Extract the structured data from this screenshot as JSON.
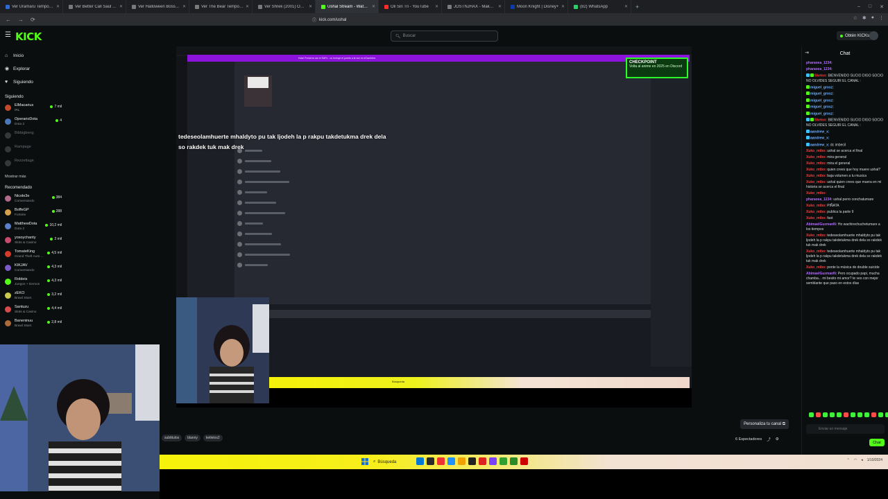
{
  "browser": {
    "tabs": [
      {
        "title": "Ver Uramaru Temporada 3 Episo",
        "color": "#2d6cd6",
        "active": false
      },
      {
        "title": "Ver Better Call Saul Temporada 4 Ep",
        "color": "#7a7a7a",
        "active": false
      },
      {
        "title": "Ver Halloween Boss Temporada 2 Episo",
        "color": "#7a7a7a",
        "active": false
      },
      {
        "title": "Ver The Bear Temporada 3 Episodio",
        "color": "#7a7a7a",
        "active": false
      },
      {
        "title": "Ver Shrek (2001) Online - Peliplus",
        "color": "#7a7a7a",
        "active": false
      },
      {
        "title": "Ushal Stream - Watch Live on",
        "color": "#53fc18",
        "active": true
      },
      {
        "title": "Oli Sin Tri - YouTube",
        "color": "#ff2b2b",
        "active": false
      },
      {
        "title": "JOSTNJHAX - Make Your Day",
        "color": "#7a7a7a",
        "active": false
      },
      {
        "title": "Moon Knight | Disney+",
        "color": "#0a3cb0",
        "active": false
      },
      {
        "title": "(82) WhatsApp",
        "color": "#25d366",
        "active": false
      }
    ],
    "new_tab": "+",
    "window_controls": [
      "–",
      "□",
      "✕"
    ],
    "url": "kick.com/ushal",
    "nav": [
      "←",
      "→",
      "⟳"
    ]
  },
  "kick": {
    "logo": "KICK",
    "search_placeholder": "Buscar",
    "get_kicks": "Obtén KICKs"
  },
  "sidebar": {
    "nav": [
      {
        "label": "Inicio",
        "icon": "home-icon",
        "glyph": "⌂"
      },
      {
        "label": "Explorar",
        "icon": "compass-icon",
        "glyph": "◉"
      },
      {
        "label": "Siguiendo",
        "icon": "heart-icon",
        "glyph": "♥"
      }
    ],
    "following_title": "Siguiendo",
    "following": [
      {
        "name": "ElMacarius",
        "category": "IRL",
        "viewers": "7 mil",
        "live": true,
        "color": "#c54a2c"
      },
      {
        "name": "OperarioDota",
        "category": "Dota 2",
        "viewers": "4",
        "live": true,
        "color": "#4a78b8"
      },
      {
        "name": "Bibbigbeng",
        "category": "",
        "viewers": "",
        "live": false,
        "color": "#888"
      },
      {
        "name": "Rampage",
        "category": "",
        "viewers": "",
        "live": false,
        "color": "#888"
      },
      {
        "name": "Rezzettage",
        "category": "",
        "viewers": "",
        "live": false,
        "color": "#888"
      }
    ],
    "show_more": "Mostrar más",
    "recommended_title": "Recomendado",
    "recommended": [
      {
        "name": "Nicole3e",
        "category": "Conversando",
        "viewers": "384",
        "color": "#b06a8a"
      },
      {
        "name": "BoffeGP",
        "category": "Fortnite",
        "viewers": "288",
        "color": "#d6a24a"
      },
      {
        "name": "MatthewDota",
        "category": "Dota 2",
        "viewers": "10,2 mil",
        "color": "#5b7ec9"
      },
      {
        "name": "yosoychanty",
        "category": "Slots & Casino",
        "viewers": "2 mil",
        "color": "#c94a6c"
      },
      {
        "name": "TomateKing",
        "category": "Grand Theft Auto ...",
        "viewers": "4,5 mil",
        "color": "#d63a2a"
      },
      {
        "name": "KIKJAV",
        "category": "Conversando",
        "viewers": "4,3 mil",
        "color": "#7a5bc9"
      },
      {
        "name": "Robleis",
        "category": "Juegos + Demos",
        "viewers": "4,3 mil",
        "color": "#53fc18"
      },
      {
        "name": "zEKO",
        "category": "Brawl Stars",
        "viewers": "3,2 mil",
        "color": "#c9c94a"
      },
      {
        "name": "Santuzu",
        "category": "Slots & Casino",
        "viewers": "4,4 mil",
        "color": "#d64a4a"
      },
      {
        "name": "Baneninuu",
        "category": "Brawl Stars",
        "viewers": "2,8 mil",
        "color": "#aa6a3a"
      }
    ]
  },
  "stream": {
    "overlay_text": "tedeseolamhuerte mhaldyto pu tak ljodeh la p rakpu takdetukma drek dela so rakdek tuk mak drek",
    "checkpoint_title": "CHECKPOINT",
    "checkpoint_sub": "Volta al anime en 2025 en Discord",
    "banner": "Hola! Preserve am el SAFe - co Incluye el puerto a la vez en el tambien."
  },
  "below": {
    "tags": [
      "subtitulos",
      "blanny",
      "ketlelos2"
    ],
    "customize": "Personaliza tu canal ⧉",
    "viewers": "6 Espectadores"
  },
  "chat": {
    "title": "Chat",
    "messages": [
      {
        "user": "pharaoea_1234:",
        "text": "",
        "color": "#b36bff",
        "badges": []
      },
      {
        "user": "pharaoea_1234:",
        "text": "",
        "color": "#b36bff",
        "badges": []
      },
      {
        "user": "Skelon:",
        "text": "BIENVENIDO SUCIO DIGO SOCIO NO OLVIDES SEGUIR EL CANAL :",
        "color": "#ff3b3b",
        "badges": [
          "#3ec1ff",
          "#53fc18"
        ]
      },
      {
        "user": "miguel_grosz:",
        "text": "",
        "color": "#6fb0ff",
        "badges": [
          "#53fc18"
        ]
      },
      {
        "user": "miguel_grosz:",
        "text": "",
        "color": "#6fb0ff",
        "badges": [
          "#53fc18"
        ]
      },
      {
        "user": "miguel_grosz:",
        "text": "",
        "color": "#6fb0ff",
        "badges": [
          "#53fc18"
        ]
      },
      {
        "user": "miguel_grosz:",
        "text": "",
        "color": "#6fb0ff",
        "badges": [
          "#53fc18"
        ]
      },
      {
        "user": "miguel_grosz:",
        "text": "",
        "color": "#6fb0ff",
        "badges": [
          "#53fc18"
        ]
      },
      {
        "user": "Skelon:",
        "text": "BIENVENIDO SUCIO DIGO SOCIO NO OLVIDES SEGUIR EL CANAL :",
        "color": "#ff3b3b",
        "badges": [
          "#3ec1ff",
          "#53fc18"
        ]
      },
      {
        "user": "aandrew_x:",
        "text": "",
        "color": "#6fb0ff",
        "badges": [
          "#3ec1ff"
        ]
      },
      {
        "user": "aandrew_x:",
        "text": "",
        "color": "#6fb0ff",
        "badges": [
          "#3ec1ff"
        ]
      },
      {
        "user": "aandrew_x:",
        "text": "dc imbecil",
        "color": "#6fb0ff",
        "badges": [
          "#3ec1ff"
        ]
      },
      {
        "user": "Xuko_mtbo:",
        "text": "ushal se acerca el final",
        "color": "#ff3b3b",
        "badges": []
      },
      {
        "user": "Xuko_mtbo:",
        "text": "mira general",
        "color": "#ff3b3b",
        "badges": []
      },
      {
        "user": "Xuko_mtbo:",
        "text": "mira el general",
        "color": "#ff3b3b",
        "badges": []
      },
      {
        "user": "Xuko_mtbo:",
        "text": "quien crees que hoy muere ushal?",
        "color": "#ff3b3b",
        "badges": []
      },
      {
        "user": "Xuko_mtbo:",
        "text": "baja volumen a tu musica",
        "color": "#ff3b3b",
        "badges": []
      },
      {
        "user": "Xuko_mtbo:",
        "text": "ushal quien crees que muera en mi historia se acerca el final",
        "color": "#ff3b3b",
        "badges": []
      },
      {
        "user": "Xuko_mtbo:",
        "text": "",
        "color": "#ff3b3b",
        "badges": []
      },
      {
        "user": "pharaoea_1234:",
        "text": "ushal perro conchatumare",
        "color": "#b36bff",
        "badges": []
      },
      {
        "user": "Xuko_mtbo:",
        "text": "PIÑATA",
        "color": "#ff3b3b",
        "badges": []
      },
      {
        "user": "Xuko_mtbo:",
        "text": "publica la parte 9",
        "color": "#ff3b3b",
        "badges": []
      },
      {
        "user": "Xuko_mtbo:",
        "text": "fast",
        "color": "#ff3b3b",
        "badges": []
      },
      {
        "user": "AbimaelGuzmanN:",
        "text": "Ho wachirechuchetumare a los tiempos",
        "color": "#b36bff",
        "badges": []
      },
      {
        "user": "Xuko_mtbo:",
        "text": "tedeseolamhuerte mhaldyto pu tak ljodeh la p rakpu takdetukma drek dela so rakdek tuk mak drek",
        "color": "#ff3b3b",
        "badges": []
      },
      {
        "user": "Xuko_mtbo:",
        "text": "tedeseolamhuerte mhaldyto pu tak ljodeh la p rakpu takdetukma drek dela so rakdek tuk mak drek",
        "color": "#ff3b3b",
        "badges": []
      },
      {
        "user": "Xuko_mtbo:",
        "text": "ponte la música de double suicide",
        "color": "#ff3b3b",
        "badges": []
      },
      {
        "user": "AbimaelGuzmanN:",
        "text": "Pero ocupado papi, mucha chamba... mi besito mi amor? te veo con mejor semblante que paso en estos días",
        "color": "#b36bff",
        "badges": []
      }
    ],
    "input_placeholder": "Enviar un mensaje",
    "send_label": "Chat"
  },
  "taskbar": {
    "search": "Búsqueda",
    "icons": [
      "#0078d4",
      "#2b2b2b",
      "#e33",
      "#1e90ff",
      "#f0a000",
      "#222",
      "#d22",
      "#7a40ff",
      "#30a030",
      "#2a8a2a",
      "#c00"
    ],
    "tray": "1/10/2024"
  }
}
